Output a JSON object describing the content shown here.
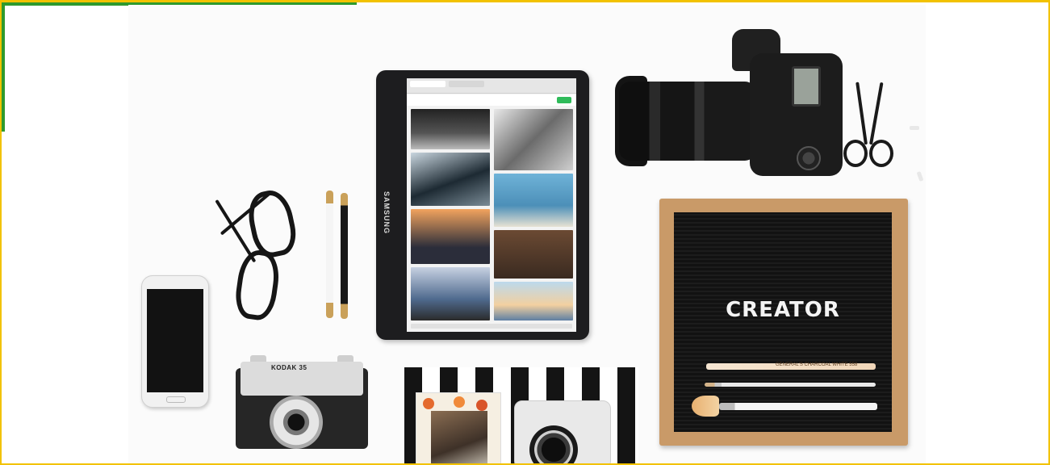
{
  "scene": {
    "description_items": [
      "tablet",
      "dslr-camera",
      "scissors",
      "letter-board",
      "glasses",
      "pens",
      "smartphone",
      "vintage-camera",
      "striped-box",
      "instant-camera",
      "postcard"
    ]
  },
  "tablet": {
    "brand": "SAMSUNG"
  },
  "vintage_camera": {
    "label": "KODAK 35"
  },
  "letter_board": {
    "word": "CREATOR",
    "pencil_label": "GENERAL'S CHARCOAL WHITE 558"
  },
  "colors": {
    "frame_border": "#f2c200",
    "corner_accent": "#2e9a2e",
    "board_wood": "#c99a68",
    "felt": "#121212"
  }
}
